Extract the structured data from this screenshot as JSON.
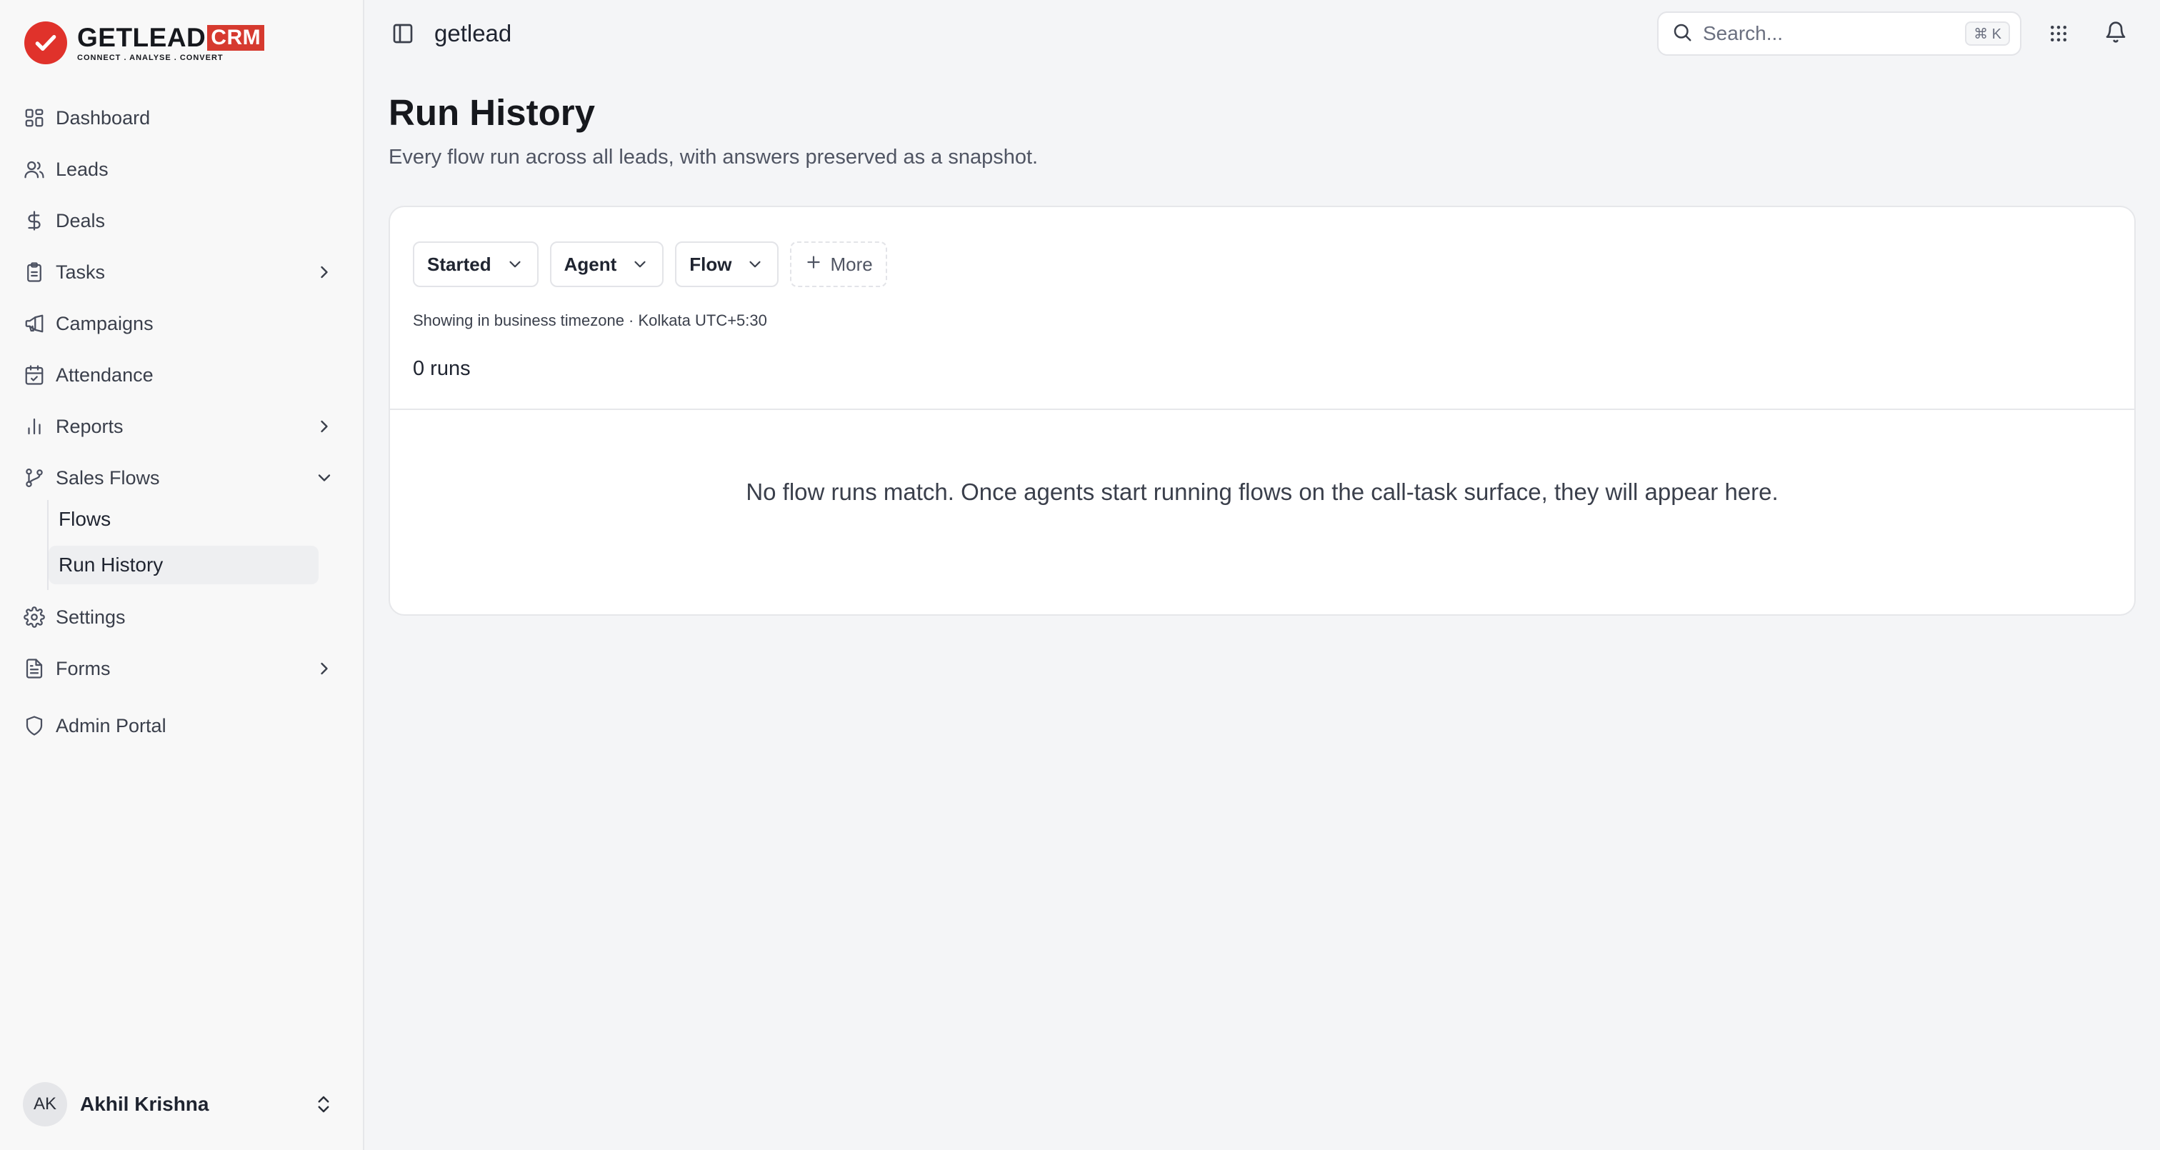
{
  "brand": {
    "name": "GETLEAD",
    "badge": "CRM",
    "tagline": "CONNECT  .  ANALYSE  .  CONVERT",
    "accent": "#e0322b"
  },
  "sidebar": {
    "items": [
      {
        "label": "Dashboard",
        "icon": "grid-icon"
      },
      {
        "label": "Leads",
        "icon": "users-icon"
      },
      {
        "label": "Deals",
        "icon": "dollar-icon"
      },
      {
        "label": "Tasks",
        "icon": "clipboard-icon"
      },
      {
        "label": "Campaigns",
        "icon": "megaphone-icon"
      },
      {
        "label": "Attendance",
        "icon": "calendar-check-icon"
      },
      {
        "label": "Reports",
        "icon": "bar-chart-icon"
      },
      {
        "label": "Sales Flows",
        "icon": "git-branch-icon"
      },
      {
        "label": "Settings",
        "icon": "gear-icon"
      },
      {
        "label": "Forms",
        "icon": "file-text-icon"
      },
      {
        "label": "Admin Portal",
        "icon": "shield-icon"
      }
    ],
    "sales_flows_children": [
      {
        "label": "Flows"
      },
      {
        "label": "Run History",
        "active": true
      }
    ],
    "user": {
      "initials": "AK",
      "name": "Akhil Krishna"
    }
  },
  "topbar": {
    "workspace": "getlead",
    "search_placeholder": "Search...",
    "search_shortcut": "⌘ K"
  },
  "page": {
    "title": "Run History",
    "subtitle": "Every flow run across all leads, with answers preserved as a snapshot."
  },
  "filters": [
    {
      "label": "Started"
    },
    {
      "label": "Agent"
    },
    {
      "label": "Flow"
    }
  ],
  "more_label": "More",
  "timezone_note": "Showing in business timezone · Kolkata UTC+5:30",
  "runs_count": "0 runs",
  "empty_message": "No flow runs match. Once agents start running flows on the call-task surface, they will appear here."
}
